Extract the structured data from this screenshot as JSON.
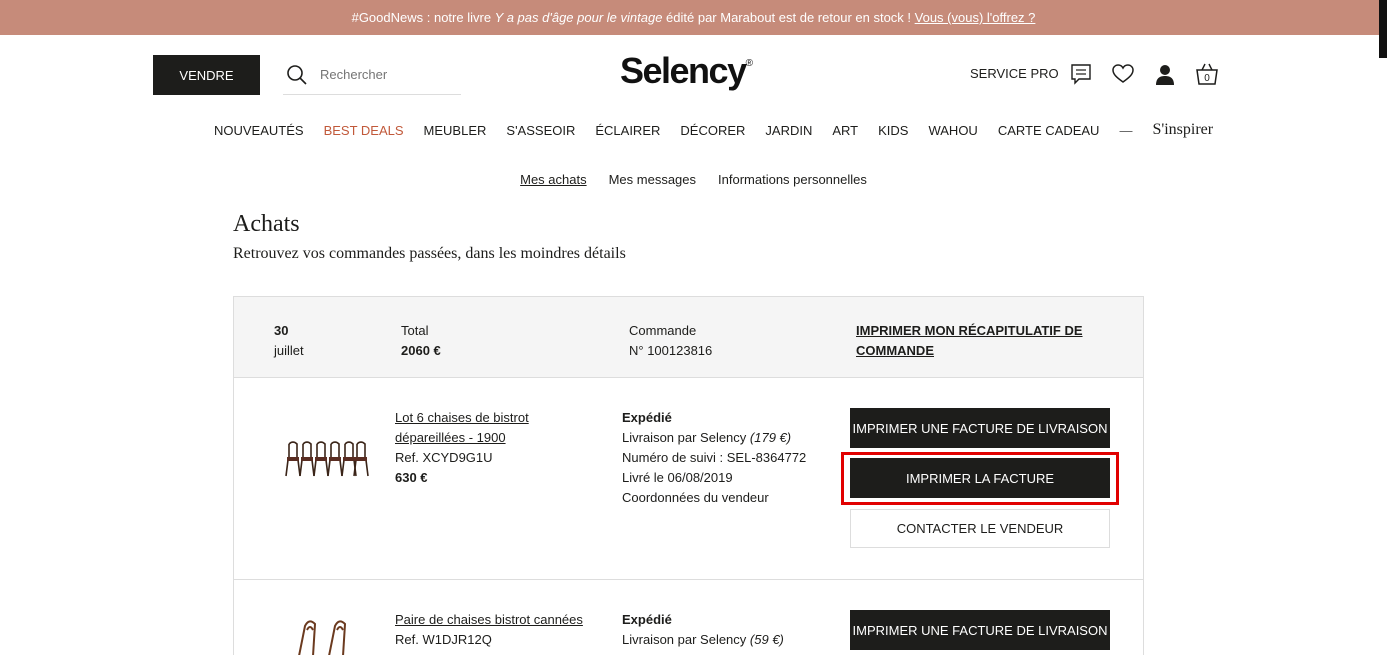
{
  "topbar": {
    "prefix": "#GoodNews : notre livre ",
    "book": "Y a pas d'âge pour le vintage",
    "suffix": " édité par Marabout est de retour en stock ! ",
    "link": "Vous (vous) l'offrez ?"
  },
  "header": {
    "sell_label": "VENDRE",
    "search_placeholder": "Rechercher",
    "logo": "Selency",
    "logo_mark": "®",
    "service_pro": "SERVICE PRO",
    "cart_count": "0"
  },
  "nav": {
    "items": [
      "NOUVEAUTÉS",
      "BEST DEALS",
      "MEUBLER",
      "S'ASSEOIR",
      "ÉCLAIRER",
      "DÉCORER",
      "JARDIN",
      "ART",
      "KIDS",
      "WAHOU",
      "CARTE CADEAU"
    ],
    "dash": "—",
    "inspire": "S'inspirer",
    "accent_color": "#c1593a"
  },
  "account_nav": {
    "items": [
      "Mes achats",
      "Mes messages",
      "Informations personnelles"
    ]
  },
  "page": {
    "title": "Achats",
    "subtitle": "Retrouvez vos commandes passées, dans les moindres détails"
  },
  "order": {
    "day": "30",
    "month": "juillet",
    "total_label": "Total",
    "total_value": "2060 €",
    "command_label": "Commande",
    "command_number": "N° 100123816",
    "print_recap": "IMPRIMER MON RÉCAPITULATIF DE COMMANDE",
    "items": [
      {
        "title_line1": "Lot 6 chaises de bistrot",
        "title_line2": "dépareillées - 1900",
        "ref": "Ref. XCYD9G1U",
        "price": "630 €",
        "status": "Expédié",
        "delivery": "Livraison par Selency",
        "delivery_price": "(179 €)",
        "tracking": "Numéro de suivi : SEL-8364772",
        "delivered": "Livré le 06/08/2019",
        "seller_info": "Coordonnées du vendeur",
        "btn_delivery_invoice": "IMPRIMER UNE FACTURE DE LIVRAISON",
        "btn_invoice": "IMPRIMER LA FACTURE",
        "btn_contact": "CONTACTER LE VENDEUR"
      },
      {
        "title_line1": "Paire de chaises bistrot cannées",
        "ref": "Ref. W1DJR12Q",
        "status": "Expédié",
        "delivery": "Livraison par Selency",
        "delivery_price": "(59 €)",
        "btn_delivery_invoice": "IMPRIMER UNE FACTURE DE LIVRAISON"
      }
    ]
  },
  "colors": {
    "topbar_bg": "#c68b7a",
    "dark": "#1d1d1b",
    "highlight": "#e10000"
  }
}
